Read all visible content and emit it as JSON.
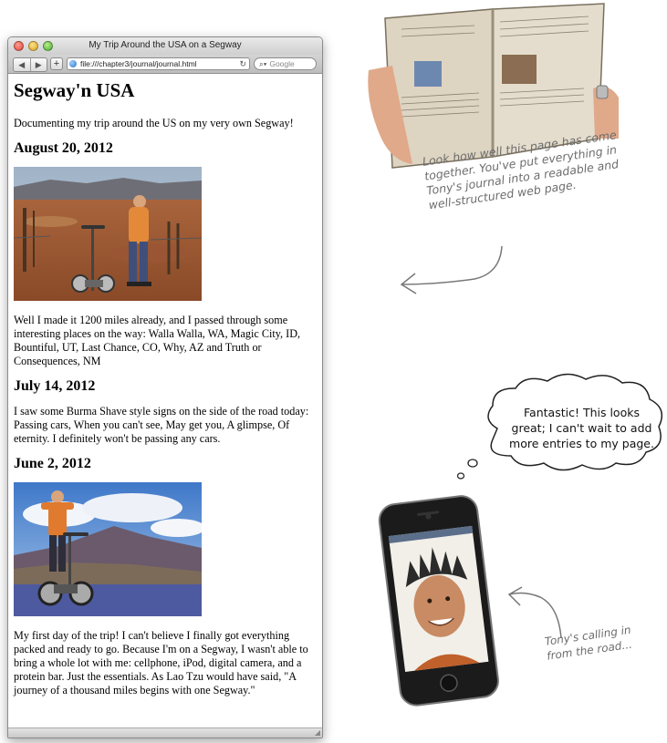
{
  "browser": {
    "window_title": "My Trip Around the USA on a Segway",
    "back_label": "◀",
    "forward_label": "▶",
    "add_label": "+",
    "url": "file:///chapter3/journal/journal.html",
    "reload_label": "↻",
    "search_placeholder": "Google"
  },
  "page": {
    "title": "Segway'n USA",
    "intro": "Documenting my trip around the US on my very own Segway!",
    "entries": [
      {
        "date": "August 20, 2012",
        "text": "Well I made it 1200 miles already, and I passed through some interesting places on the way: Walla Walla, WA, Magic City, ID, Bountiful, UT, Last Chance, CO, Why, AZ and Truth or Consequences, NM"
      },
      {
        "date": "July 14, 2012",
        "text": "I saw some Burma Shave style signs on the side of the road today: Passing cars, When you can't see, May get you, A glimpse, Of eternity. I definitely won't be passing any cars."
      },
      {
        "date": "June 2, 2012",
        "text": "My first day of the trip! I can't believe I finally got everything packed and ready to go. Because I'm on a Segway, I wasn't able to bring a whole lot with me: cellphone, iPod, digital camera, and a protein bar. Just the essentials. As Lao Tzu would have said, \"A journey of a thousand miles begins with one Segway.\""
      }
    ]
  },
  "annotations": {
    "journal_note": "Look how well this page has come together. You've put everything in Tony's journal into a readable and well-structured web page.",
    "thought_bubble": "Fantastic! This looks great; I can't wait to add more entries to my page.",
    "phone_note": "Tony's calling in from the road..."
  },
  "icons": {
    "globe": "globe-icon",
    "search": "magnifier-icon",
    "resize": "resize-grip-icon"
  },
  "colors": {
    "annotation_gray": "#6d6d6d",
    "window_chrome": "#cfcfcf"
  }
}
